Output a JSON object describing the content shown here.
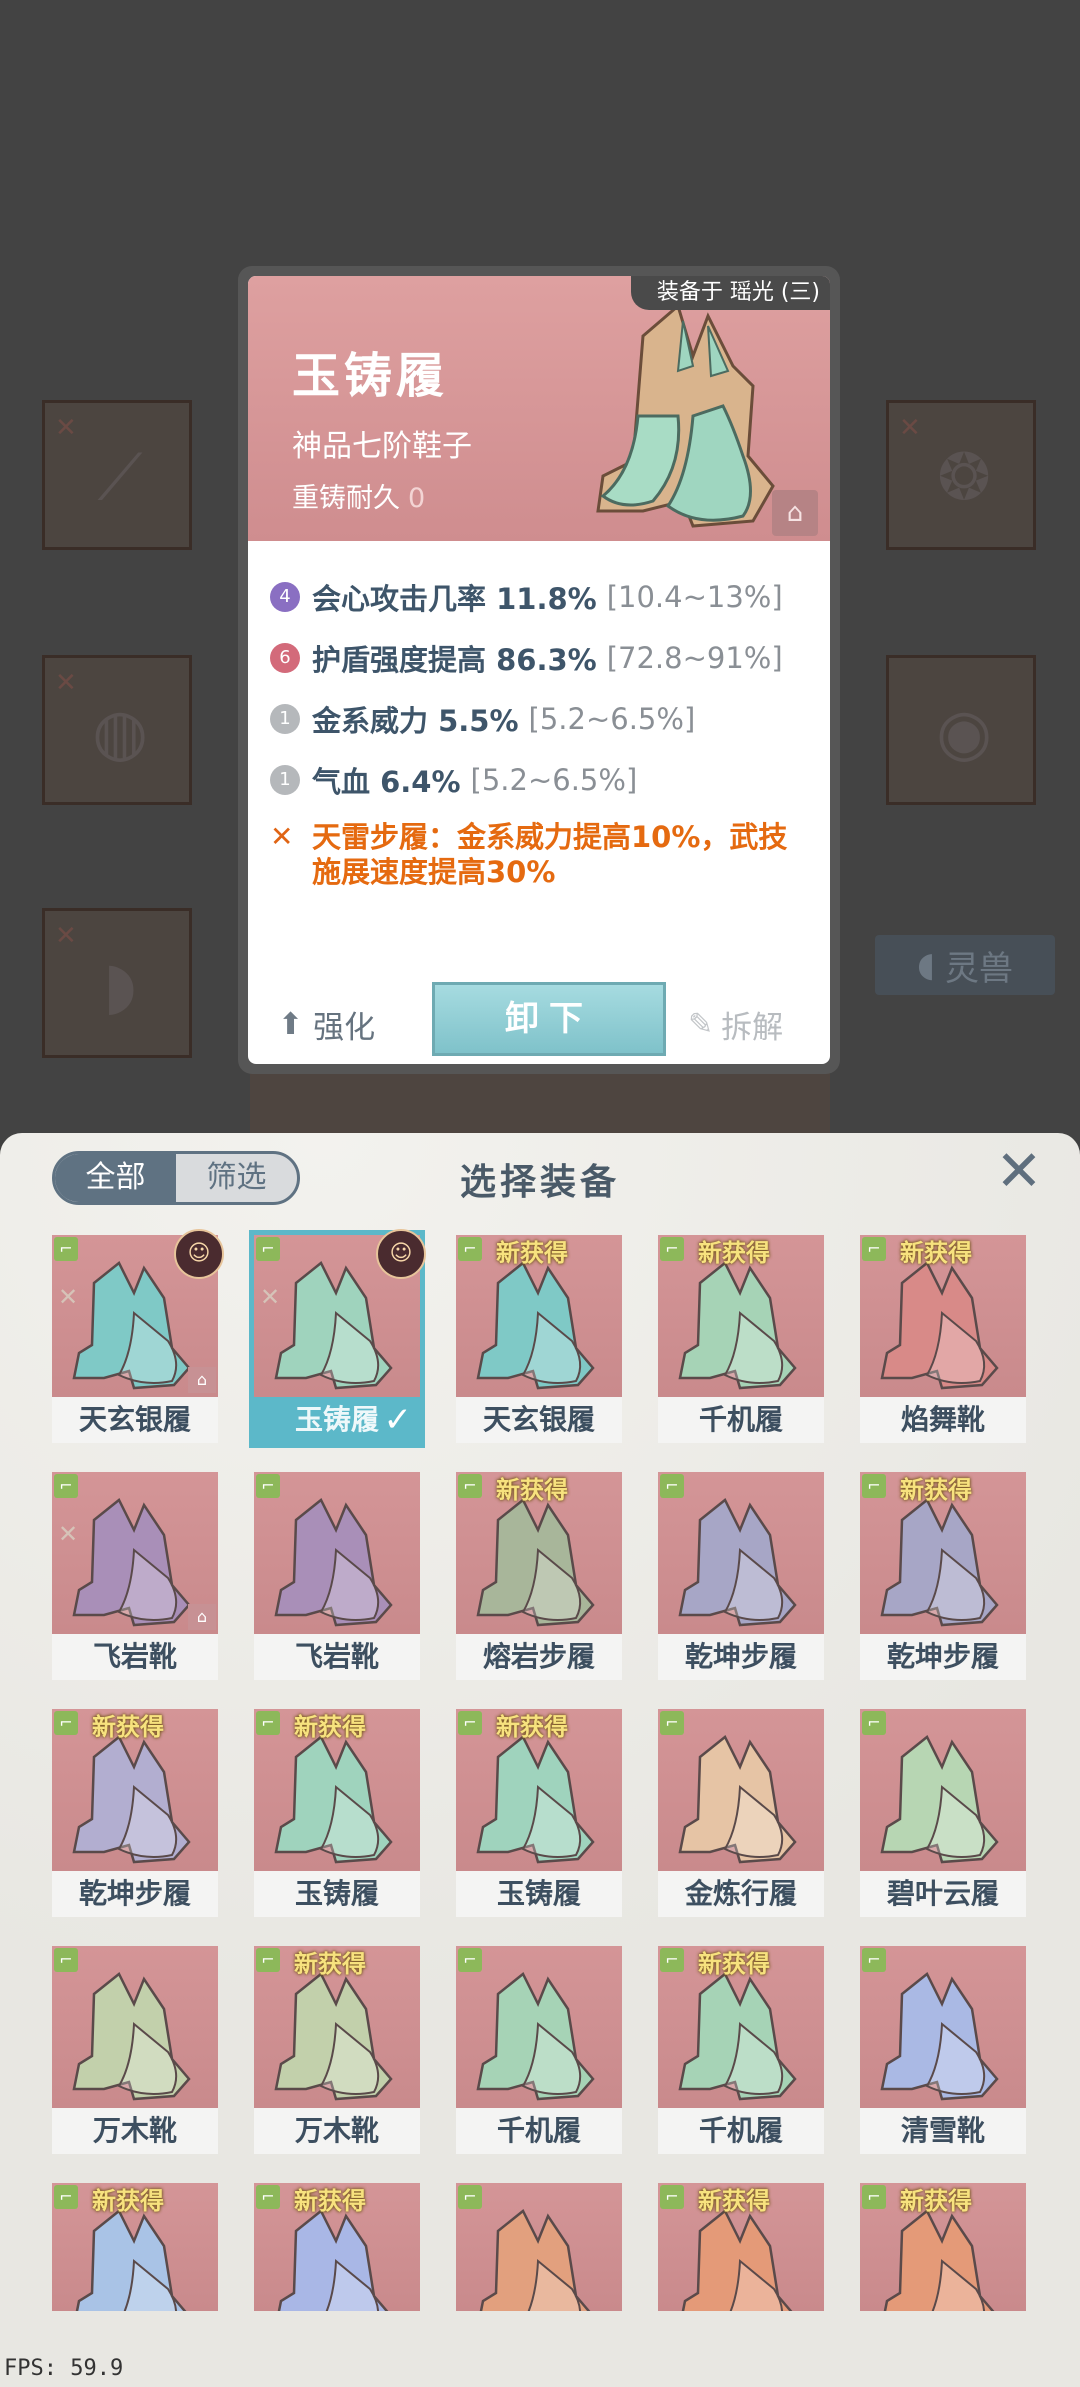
{
  "card": {
    "equipped_on": "装备于 瑶光 (三)",
    "name": "玉铸履",
    "grade": "神品七阶鞋子",
    "reforge_label": "重铸耐久",
    "reforge_value": "0",
    "stats": [
      {
        "badge": "4",
        "badge_color": "#8a6fc2",
        "text": "会心攻击几率 11.8%",
        "range": "[10.4~13%]"
      },
      {
        "badge": "6",
        "badge_color": "#d36a7a",
        "text": "护盾强度提高 86.3%",
        "range": "[72.8~91%]"
      },
      {
        "badge": "1",
        "badge_color": "#b5b8bb",
        "text": "金系威力 5.5%",
        "range": "[5.2~6.5%]"
      },
      {
        "badge": "1",
        "badge_color": "#b5b8bb",
        "text": "气血 6.4%",
        "range": "[5.2~6.5%]"
      }
    ],
    "special": "天雷步履：金系威力提高10%，武技施展速度提高30%",
    "upgrade": "强化",
    "unequip": "卸下",
    "dismantle": "拆解"
  },
  "background": {
    "beast_button": "灵兽"
  },
  "panel": {
    "tab_all": "全部",
    "tab_filter": "筛选",
    "title": "选择装备",
    "items": [
      {
        "name": "天玄银履",
        "tint": "#7fc9c6",
        "new": false,
        "set": true,
        "lock": true,
        "avatar": true,
        "selected": false
      },
      {
        "name": "玉铸履",
        "tint": "#9fd3bd",
        "new": false,
        "set": true,
        "lock": false,
        "avatar": true,
        "selected": true
      },
      {
        "name": "天玄银履",
        "tint": "#7fc9c6",
        "new": true,
        "set": false,
        "lock": false,
        "avatar": false,
        "selected": false
      },
      {
        "name": "千机履",
        "tint": "#a6d3b6",
        "new": true,
        "set": false,
        "lock": false,
        "avatar": false,
        "selected": false
      },
      {
        "name": "焰舞靴",
        "tint": "#d88a88",
        "new": true,
        "set": false,
        "lock": false,
        "avatar": false,
        "selected": false
      },
      {
        "name": "飞岩靴",
        "tint": "#a98fb8",
        "new": false,
        "set": true,
        "lock": true,
        "avatar": false,
        "selected": false
      },
      {
        "name": "飞岩靴",
        "tint": "#a98fb8",
        "new": false,
        "set": false,
        "lock": false,
        "avatar": false,
        "selected": false
      },
      {
        "name": "熔岩步履",
        "tint": "#a8b69a",
        "new": true,
        "set": false,
        "lock": false,
        "avatar": false,
        "selected": false
      },
      {
        "name": "乾坤步履",
        "tint": "#a7a6c6",
        "new": false,
        "set": false,
        "lock": false,
        "avatar": false,
        "selected": false
      },
      {
        "name": "乾坤步履",
        "tint": "#a7a6c6",
        "new": true,
        "set": false,
        "lock": false,
        "avatar": false,
        "selected": false
      },
      {
        "name": "乾坤步履",
        "tint": "#b2aed0",
        "new": true,
        "set": false,
        "lock": false,
        "avatar": false,
        "selected": false
      },
      {
        "name": "玉铸履",
        "tint": "#9fd3bd",
        "new": true,
        "set": false,
        "lock": false,
        "avatar": false,
        "selected": false
      },
      {
        "name": "玉铸履",
        "tint": "#9fd3bd",
        "new": true,
        "set": false,
        "lock": false,
        "avatar": false,
        "selected": false
      },
      {
        "name": "金炼行履",
        "tint": "#e6c4a5",
        "new": false,
        "set": false,
        "lock": false,
        "avatar": false,
        "selected": false
      },
      {
        "name": "碧叶云履",
        "tint": "#b7d6b3",
        "new": false,
        "set": false,
        "lock": false,
        "avatar": false,
        "selected": false
      },
      {
        "name": "万木靴",
        "tint": "#c2d0ab",
        "new": false,
        "set": false,
        "lock": false,
        "avatar": false,
        "selected": false
      },
      {
        "name": "万木靴",
        "tint": "#c2d0ab",
        "new": true,
        "set": false,
        "lock": false,
        "avatar": false,
        "selected": false
      },
      {
        "name": "千机履",
        "tint": "#a6d3b6",
        "new": false,
        "set": false,
        "lock": false,
        "avatar": false,
        "selected": false
      },
      {
        "name": "千机履",
        "tint": "#a6d3b6",
        "new": true,
        "set": false,
        "lock": false,
        "avatar": false,
        "selected": false
      },
      {
        "name": "清雪靴",
        "tint": "#aab9e4",
        "new": false,
        "set": false,
        "lock": false,
        "avatar": false,
        "selected": false
      },
      {
        "name": "",
        "tint": "#a9c3e6",
        "new": true,
        "set": false,
        "lock": false,
        "avatar": false,
        "selected": false
      },
      {
        "name": "",
        "tint": "#a9b7e6",
        "new": true,
        "set": false,
        "lock": false,
        "avatar": false,
        "selected": false
      },
      {
        "name": "",
        "tint": "#e2a07e",
        "new": false,
        "set": false,
        "lock": false,
        "avatar": false,
        "selected": false
      },
      {
        "name": "",
        "tint": "#e49a78",
        "new": true,
        "set": false,
        "lock": false,
        "avatar": false,
        "selected": false
      },
      {
        "name": "",
        "tint": "#e49a78",
        "new": true,
        "set": false,
        "lock": false,
        "avatar": false,
        "selected": false
      }
    ],
    "new_tag": "新获得"
  },
  "fps": "FPS: 59.9"
}
